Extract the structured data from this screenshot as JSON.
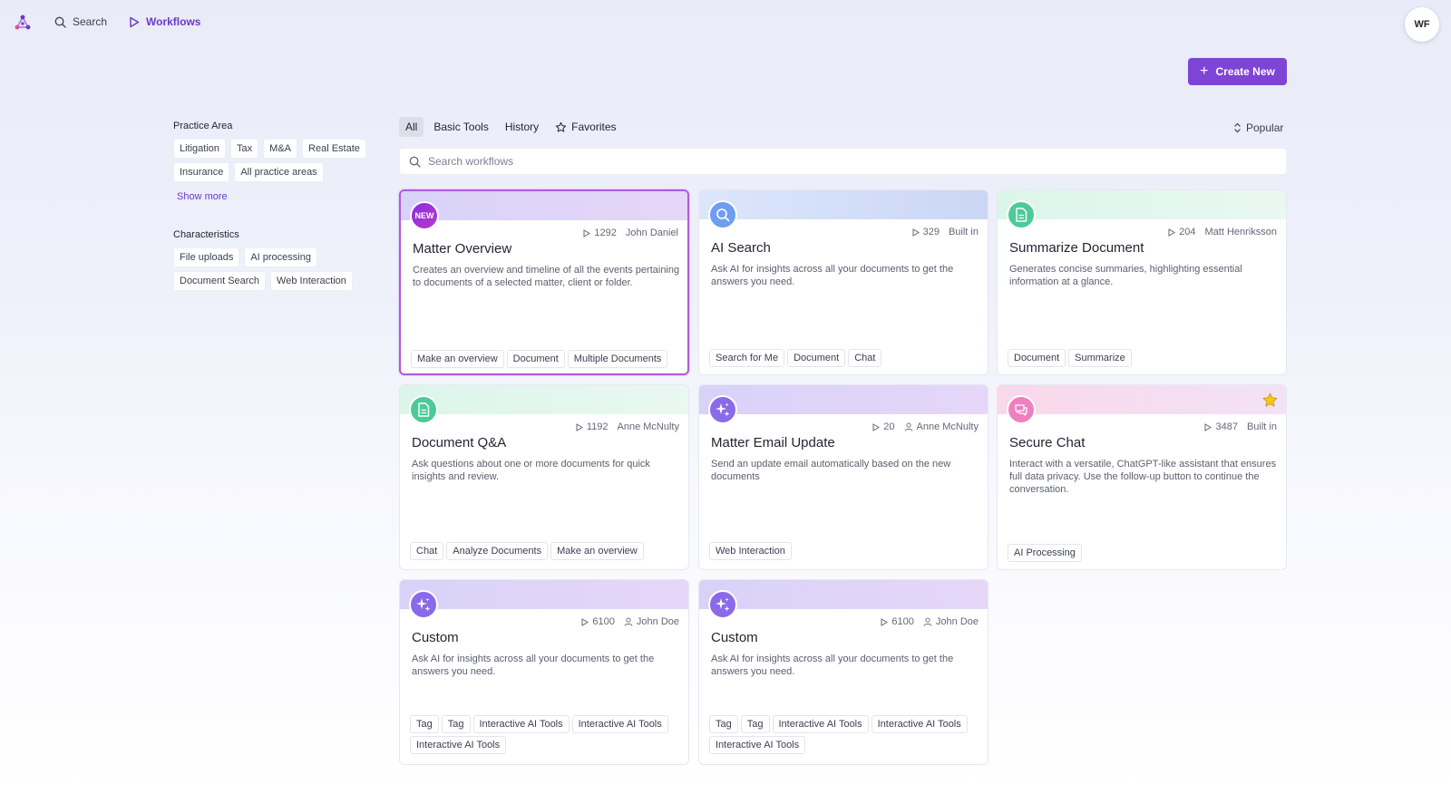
{
  "nav": {
    "search_label": "Search",
    "workflows_label": "Workflows",
    "avatar_initials": "WF",
    "create_label": "Create New"
  },
  "sidebar": {
    "practice_title": "Practice Area",
    "practice_chips": [
      "Litigation",
      "Tax",
      "M&A",
      "Real Estate",
      "Insurance",
      "All practice areas"
    ],
    "show_more": "Show more",
    "characteristics_title": "Characteristics",
    "characteristics_chips": [
      "File uploads",
      "AI processing",
      "Document Search",
      "Web Interaction"
    ]
  },
  "tabs": {
    "all": "All",
    "basic_tools": "Basic Tools",
    "history": "History",
    "favorites": "Favorites",
    "sort_label": "Popular"
  },
  "search": {
    "placeholder": "Search workflows"
  },
  "colors": {
    "accent": "#7e44d6",
    "star": "#f5c518"
  },
  "cards": [
    {
      "badge": "NEW",
      "icon": "new-badge",
      "runs": "1292",
      "author": "John Daniel",
      "title": "Matter Overview",
      "desc": "Creates an overview and timeline of all the events pertaining to documents of a selected matter, client or folder.",
      "tags": [
        "Make an overview",
        "Document",
        "Multiple Documents"
      ]
    },
    {
      "icon": "search-icon",
      "runs": "329",
      "author": "Built in",
      "title": "AI Search",
      "desc": "Ask AI for insights across all your documents to get the answers you need.",
      "tags": [
        "Search for Me",
        "Document",
        "Chat"
      ]
    },
    {
      "icon": "document-icon",
      "runs": "204",
      "author": "Matt Henriksson",
      "title": "Summarize Document",
      "desc": "Generates concise summaries, highlighting essential information at a glance.",
      "tags": [
        "Document",
        "Summarize"
      ]
    },
    {
      "icon": "document-icon",
      "runs": "1192",
      "author": "Anne McNulty",
      "title": "Document Q&A",
      "desc": "Ask questions about one or more documents for quick insights and review.",
      "tags": [
        "Chat",
        "Analyze Documents",
        "Make an overview"
      ]
    },
    {
      "icon": "sparkle-icon",
      "runs": "20",
      "author": "Anne McNulty",
      "title": "Matter Email Update",
      "desc": "Send an update email automatically based on the new documents",
      "tags": [
        "Web Interaction"
      ]
    },
    {
      "icon": "chat-icon",
      "runs": "3487",
      "author": "Built in",
      "title": "Secure Chat",
      "desc": "Interact with a versatile, ChatGPT-like assistant that ensures full data privacy. Use the follow-up button to continue the conversation.",
      "tags": [
        "AI Processing"
      ]
    },
    {
      "icon": "sparkle-icon",
      "runs": "6100",
      "author": "John Doe",
      "title": "Custom",
      "desc": "Ask AI for insights across all your documents to get the answers you need.",
      "tags": [
        "Tag",
        "Tag",
        "Interactive AI Tools",
        "Interactive AI Tools",
        "Interactive AI Tools"
      ]
    },
    {
      "icon": "sparkle-icon",
      "runs": "6100",
      "author": "John Doe",
      "title": "Custom",
      "desc": "Ask AI for insights across all your documents to get the answers you need.",
      "tags": [
        "Tag",
        "Tag",
        "Interactive AI Tools",
        "Interactive AI Tools",
        "Interactive AI Tools"
      ]
    }
  ]
}
